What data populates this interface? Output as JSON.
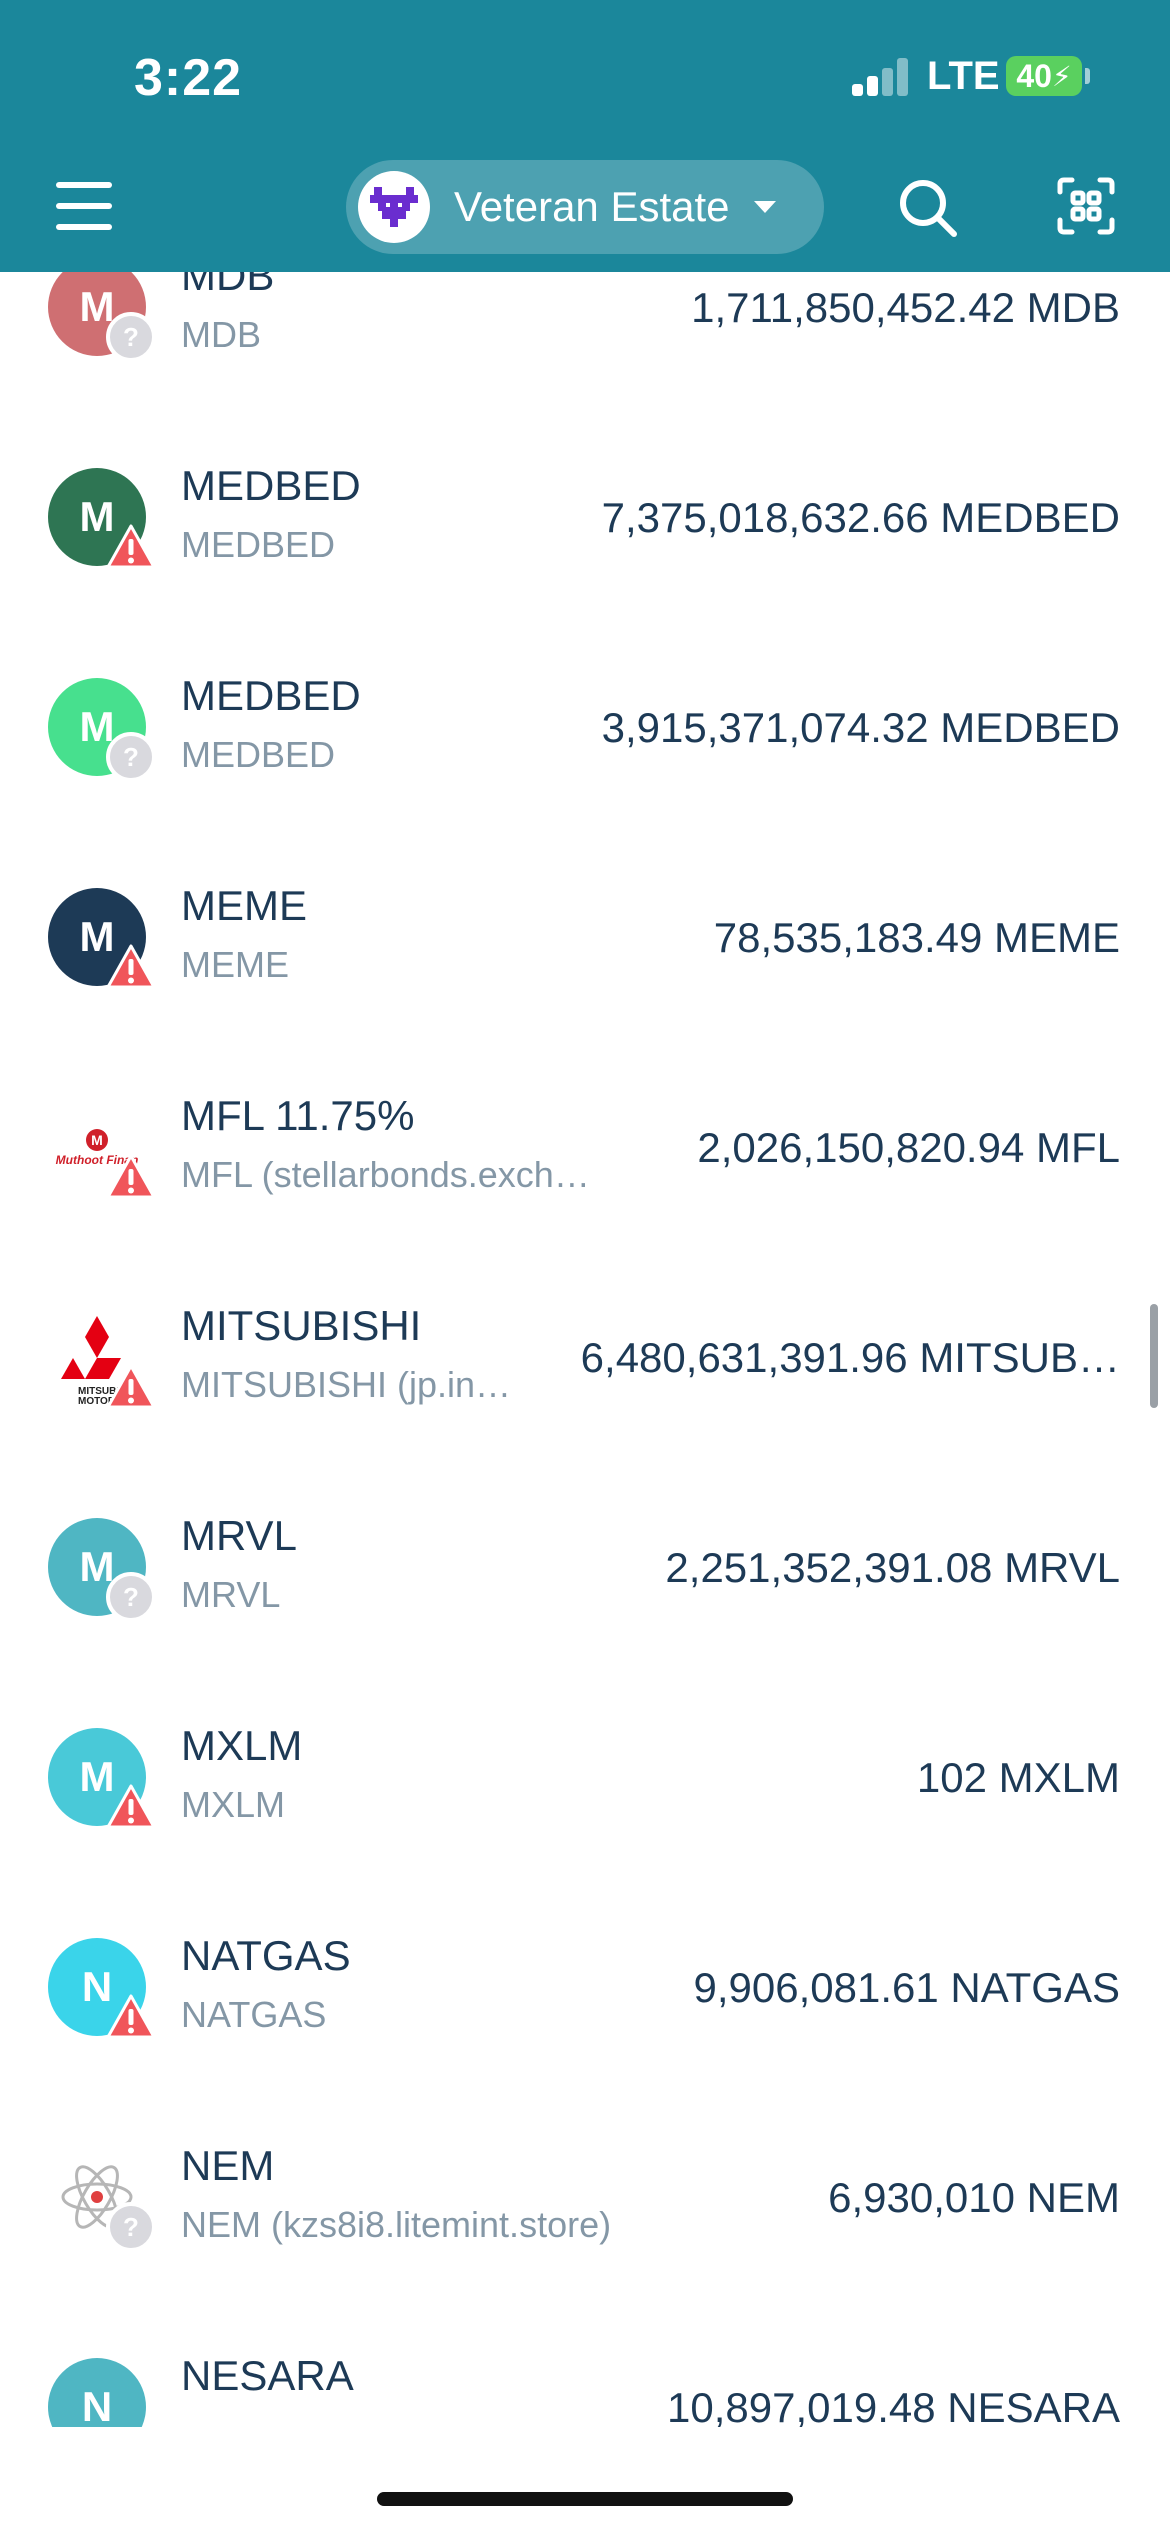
{
  "status_bar": {
    "time": "3:22",
    "network": "LTE",
    "battery": "40"
  },
  "header": {
    "wallet_name": "Veteran Estate"
  },
  "colors": {
    "header_bg": "#1b879b",
    "warning": "#f0555a",
    "unknown_badge": "#d9d9de"
  },
  "assets": [
    {
      "name": "MDB",
      "issuer": "MDB",
      "balance": "1,711,850,452.42 MDB",
      "avatar_letter": "M",
      "avatar_color": "#cf6f72",
      "badge": "question-icon"
    },
    {
      "name": "MEDBED",
      "issuer": "MEDBED",
      "balance": "7,375,018,632.66 MEDBED",
      "avatar_letter": "M",
      "avatar_color": "#2e7553",
      "badge": "warning-icon"
    },
    {
      "name": "MEDBED",
      "issuer": "MEDBED",
      "balance": "3,915,371,074.32 MEDBED",
      "avatar_letter": "M",
      "avatar_color": "#47e08e",
      "badge": "question-icon"
    },
    {
      "name": "MEME",
      "issuer": "MEME",
      "balance": "78,535,183.49 MEME",
      "avatar_letter": "M",
      "avatar_color": "#1d3a56",
      "badge": "warning-icon"
    },
    {
      "name": "MFL 11.75%",
      "issuer": "MFL (stellarbonds.exch…",
      "balance": "2,026,150,820.94 MFL",
      "avatar_logo": "muthoot-logo",
      "badge": "warning-icon"
    },
    {
      "name": "MITSUBISHI",
      "issuer": "MITSUBISHI (jp.in…",
      "balance": "6,480,631,391.96 MITSUB…",
      "avatar_logo": "mitsubishi-logo",
      "badge": "warning-icon"
    },
    {
      "name": "MRVL",
      "issuer": "MRVL",
      "balance": "2,251,352,391.08 MRVL",
      "avatar_letter": "M",
      "avatar_color": "#4fb6c3",
      "badge": "question-icon"
    },
    {
      "name": "MXLM",
      "issuer": "MXLM",
      "balance": "102 MXLM",
      "avatar_letter": "M",
      "avatar_color": "#49c9d8",
      "badge": "warning-icon"
    },
    {
      "name": "NATGAS",
      "issuer": "NATGAS",
      "balance": "9,906,081.61 NATGAS",
      "avatar_letter": "N",
      "avatar_color": "#3ad4ea",
      "badge": "warning-icon"
    },
    {
      "name": "NEM",
      "issuer": "NEM (kzs8i8.litemint.store)",
      "balance": "6,930,010 NEM",
      "avatar_logo": "nem-logo",
      "badge": "question-icon"
    },
    {
      "name": "NESARA",
      "issuer": "",
      "balance": "10,897,019.48 NESARA",
      "avatar_letter": "N",
      "avatar_color": "#4fb6c3",
      "badge": ""
    }
  ]
}
